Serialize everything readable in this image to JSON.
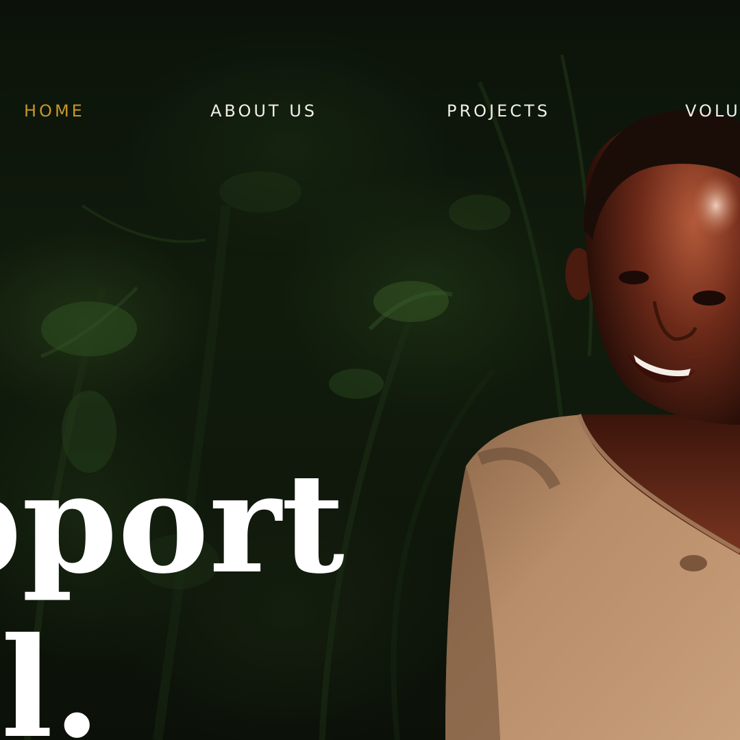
{
  "nav": {
    "items": [
      {
        "label": "HOME",
        "active": true
      },
      {
        "label": "ABOUT US",
        "active": false
      },
      {
        "label": "PROJECTS",
        "active": false
      },
      {
        "label": "VOLU",
        "active": false
      }
    ],
    "active_color": "#c8962b",
    "text_color": "#f1efe9"
  },
  "hero": {
    "headline_line_1": "pport",
    "headline_line_2": "ful."
  }
}
